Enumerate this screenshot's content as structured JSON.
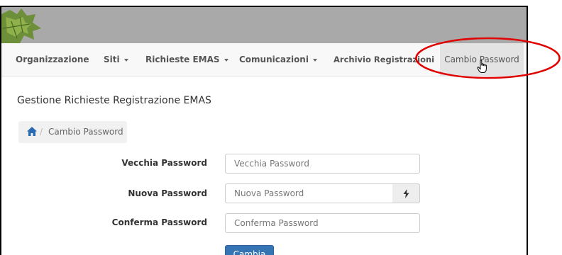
{
  "nav": {
    "items": [
      {
        "label": "Organizzazione",
        "has_caret": false
      },
      {
        "label": "Siti",
        "has_caret": true
      },
      {
        "label": "Richieste EMAS",
        "has_caret": true
      },
      {
        "label": "Comunicazioni",
        "has_caret": true
      },
      {
        "label": "Archivio Registrazioni",
        "has_caret": false
      }
    ],
    "active_label": "Cambio Password"
  },
  "page": {
    "title": "Gestione Richieste Registrazione EMAS",
    "breadcrumb_current": "Cambio Password"
  },
  "form": {
    "old_password": {
      "label": "Vecchia Password",
      "placeholder": "Vecchia Password"
    },
    "new_password": {
      "label": "Nuova Password",
      "placeholder": "Nuova Password"
    },
    "confirm_password": {
      "label": "Conferma Password",
      "placeholder": "Conferma Password"
    },
    "submit_label": "Cambia"
  },
  "colors": {
    "banner": "#a9a9a9",
    "primary_button": "#3675b4",
    "highlight_ellipse": "#e00000"
  },
  "icons": {
    "home": "home-icon",
    "generate": "lightning-bolt-icon",
    "cursor": "hand-pointer-cursor"
  }
}
